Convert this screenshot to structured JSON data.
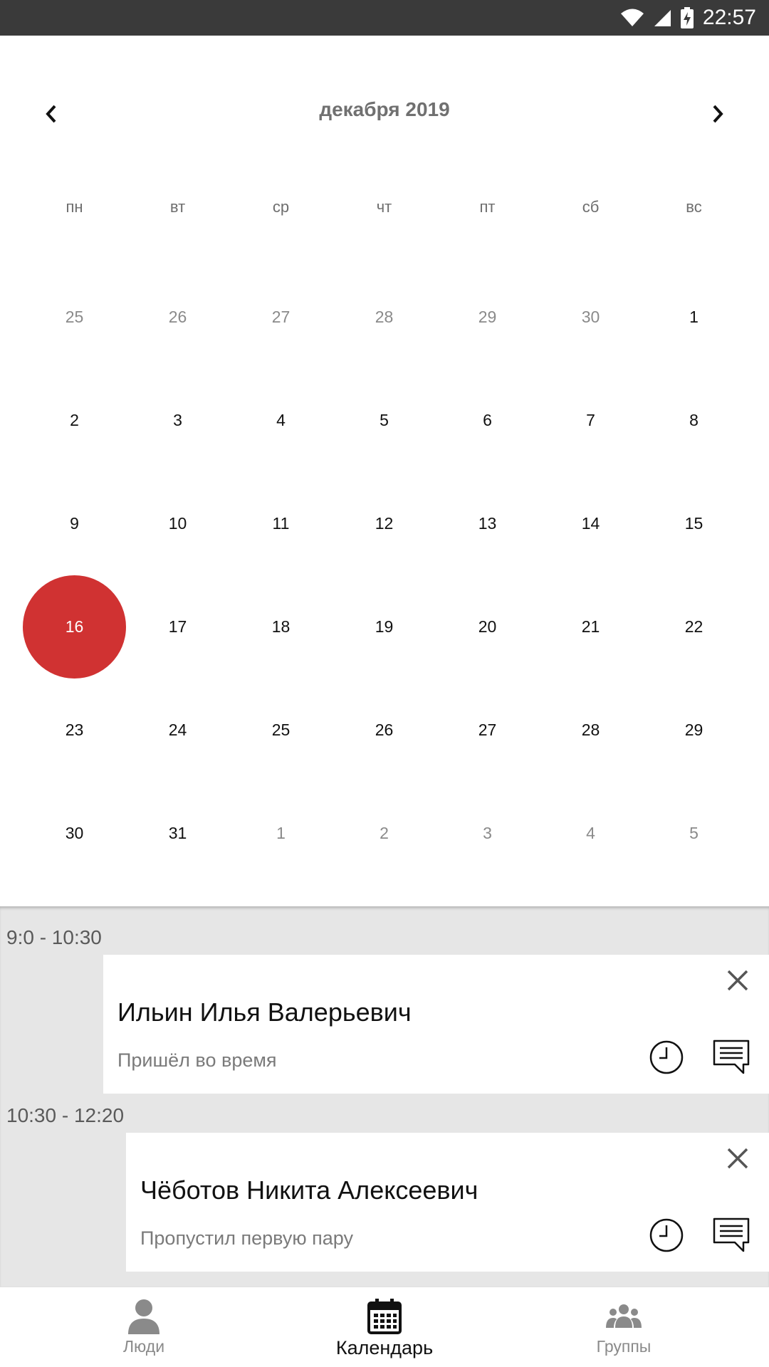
{
  "status_bar": {
    "time": "22:57"
  },
  "calendar": {
    "month_title": "декабря 2019",
    "weekdays": [
      "пн",
      "вт",
      "ср",
      "чт",
      "пт",
      "сб",
      "вс"
    ],
    "weeks": [
      [
        {
          "d": "25",
          "m": true
        },
        {
          "d": "26",
          "m": true
        },
        {
          "d": "27",
          "m": true
        },
        {
          "d": "28",
          "m": true
        },
        {
          "d": "29",
          "m": true
        },
        {
          "d": "30",
          "m": true
        },
        {
          "d": "1"
        }
      ],
      [
        {
          "d": "2"
        },
        {
          "d": "3"
        },
        {
          "d": "4"
        },
        {
          "d": "5"
        },
        {
          "d": "6"
        },
        {
          "d": "7"
        },
        {
          "d": "8"
        }
      ],
      [
        {
          "d": "9"
        },
        {
          "d": "10"
        },
        {
          "d": "11"
        },
        {
          "d": "12"
        },
        {
          "d": "13"
        },
        {
          "d": "14"
        },
        {
          "d": "15"
        }
      ],
      [
        {
          "d": "16",
          "sel": true
        },
        {
          "d": "17"
        },
        {
          "d": "18"
        },
        {
          "d": "19"
        },
        {
          "d": "20"
        },
        {
          "d": "21"
        },
        {
          "d": "22"
        }
      ],
      [
        {
          "d": "23"
        },
        {
          "d": "24"
        },
        {
          "d": "25"
        },
        {
          "d": "26"
        },
        {
          "d": "27"
        },
        {
          "d": "28"
        },
        {
          "d": "29"
        }
      ],
      [
        {
          "d": "30"
        },
        {
          "d": "31"
        },
        {
          "d": "1",
          "m": true
        },
        {
          "d": "2",
          "m": true
        },
        {
          "d": "3",
          "m": true
        },
        {
          "d": "4",
          "m": true
        },
        {
          "d": "5",
          "m": true
        }
      ]
    ],
    "selected_color": "#d03232"
  },
  "events": [
    {
      "time": "9:0 - 10:30",
      "name": "Ильин Илья Валерьевич",
      "status": "Пришёл во время"
    },
    {
      "time": "10:30 - 12:20",
      "name": "Чёботов Никита Алексеевич",
      "status": "Пропустил первую пару"
    }
  ],
  "bottom_nav": {
    "items": [
      {
        "label": "Люди",
        "icon": "person-icon",
        "active": false
      },
      {
        "label": "Календарь",
        "icon": "calendar-icon",
        "active": true
      },
      {
        "label": "Группы",
        "icon": "group-icon",
        "active": false
      }
    ]
  }
}
